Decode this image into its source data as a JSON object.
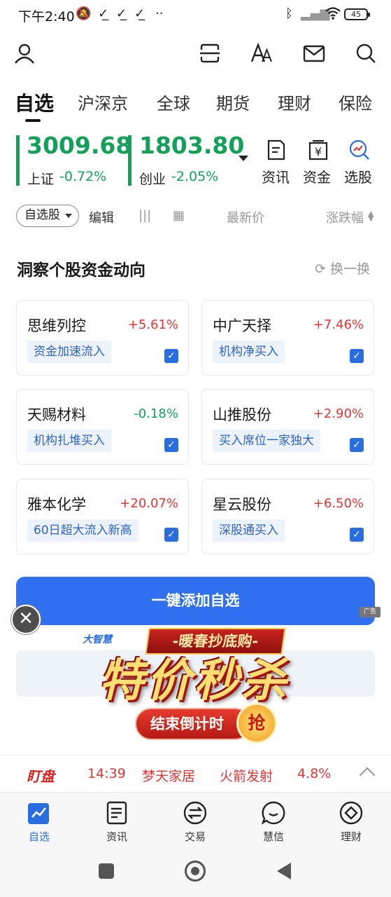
{
  "status_bar": {
    "time": "下午2:40",
    "battery": "45"
  },
  "tabs": [
    {
      "label": "自选",
      "active": true
    },
    {
      "label": "沪深京"
    },
    {
      "label": "全球"
    },
    {
      "label": "期货"
    },
    {
      "label": "理财"
    },
    {
      "label": "保险"
    }
  ],
  "indices": [
    {
      "value": "3009.68",
      "name": "上证",
      "change": "-0.72%"
    },
    {
      "value": "1803.80",
      "name": "创业",
      "change": "-2.05%"
    }
  ],
  "quick_links": [
    {
      "label": "资讯",
      "icon": "news-doc-icon"
    },
    {
      "label": "资金",
      "icon": "yuan-fund-icon"
    },
    {
      "label": "选股",
      "icon": "stock-pick-icon"
    }
  ],
  "filter_row": {
    "group": "自选股",
    "edit": "编辑",
    "latest_price": "最新价",
    "change_pct": "涨跌幅"
  },
  "insight": {
    "title": "洞察个股资金动向",
    "refresh": "换一换",
    "cards": [
      {
        "name": "思维列控",
        "change": "+5.61%",
        "tag": "资金加速流入",
        "dir": "up"
      },
      {
        "name": "中广天择",
        "change": "+7.46%",
        "tag": "机构净买入",
        "dir": "up"
      },
      {
        "name": "天赐材料",
        "change": "-0.18%",
        "tag": "机构扎堆买入",
        "dir": "down"
      },
      {
        "name": "山推股份",
        "change": "+2.90%",
        "tag": "买入席位一家独大",
        "dir": "up"
      },
      {
        "name": "雅本化学",
        "change": "+20.07%",
        "tag": "60日超大流入新高",
        "dir": "up"
      },
      {
        "name": "星云股份",
        "change": "+6.50%",
        "tag": "深股通买入",
        "dir": "up"
      }
    ],
    "add_button": "一键添加自选"
  },
  "ad": {
    "mark": "广告",
    "brand": "大智慧",
    "top_text": "-暖春抄底购-",
    "headline": "特价秒杀",
    "countdown": "结束倒计时",
    "grab": "抢"
  },
  "ticker": {
    "logo": "盯盘",
    "time": "14:39",
    "stock": "梦天家居",
    "event": "火箭发射",
    "pct": "4.8%"
  },
  "bottom_nav": [
    {
      "label": "自选",
      "active": true
    },
    {
      "label": "资讯"
    },
    {
      "label": "交易"
    },
    {
      "label": "慧信"
    },
    {
      "label": "理财"
    }
  ],
  "colors": {
    "up": "#e23636",
    "down": "#13a05b",
    "accent": "#2f6ff0"
  }
}
